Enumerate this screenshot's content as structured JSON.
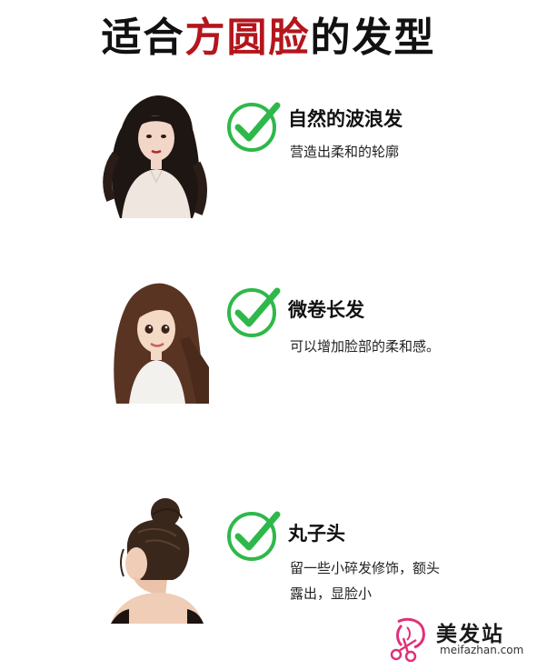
{
  "header": {
    "title_part1": "适合",
    "title_highlight": "方圆脸",
    "title_part2": "的发型"
  },
  "colors": {
    "highlight": "#b3161c",
    "check_green": "#2fb84a",
    "logo_pink": "#e0307a"
  },
  "items": [
    {
      "title": "自然的波浪发",
      "desc": "营造出柔和的轮廓",
      "icon": "check-icon"
    },
    {
      "title": "微卷长发",
      "desc": "可以增加脸部的柔和感。",
      "icon": "check-icon"
    },
    {
      "title": "丸子头",
      "desc_line1": "留一些小碎发修饰，额头",
      "desc_line2": "露出，显脸小",
      "icon": "check-icon"
    }
  ],
  "logo": {
    "name": "美发站",
    "url": "meifazhan.com",
    "icon": "scissors-woman-icon"
  }
}
